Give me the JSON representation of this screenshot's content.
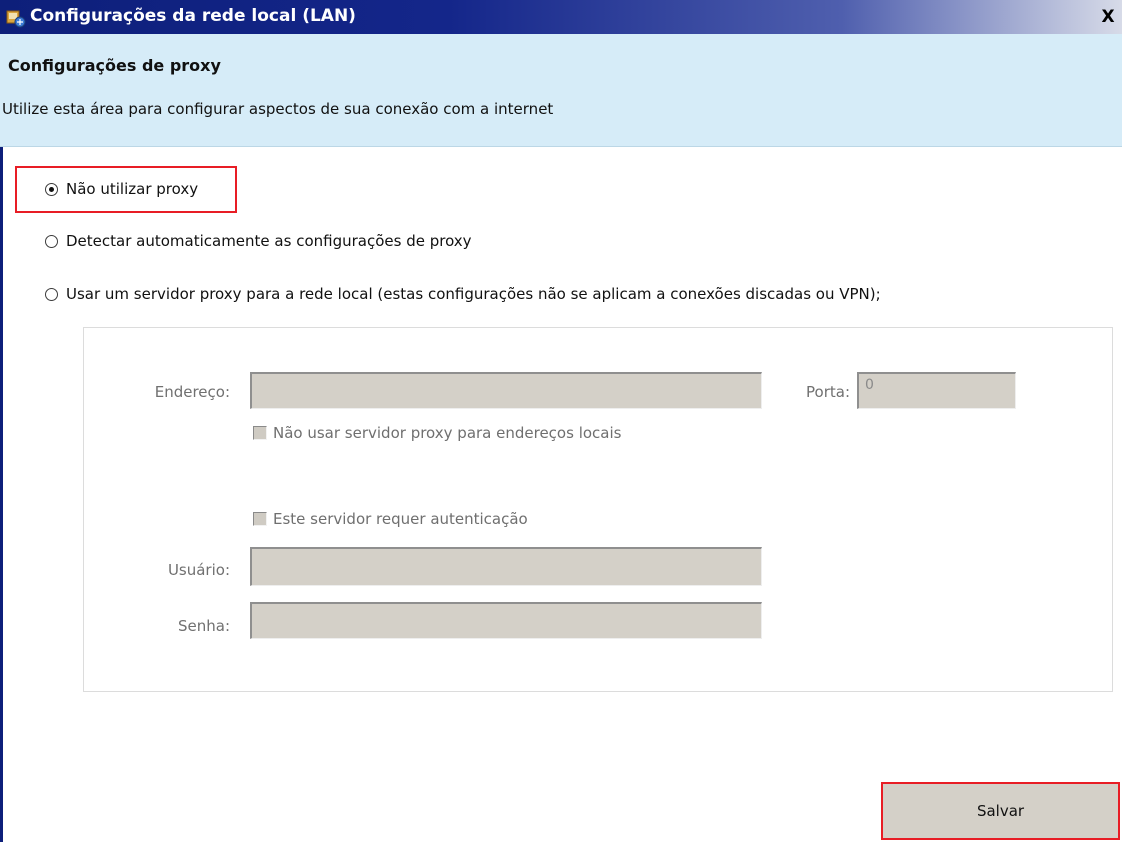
{
  "window": {
    "title": "Configurações da rede local (LAN)",
    "close_symbol": "X"
  },
  "header": {
    "heading": "Configurações de proxy",
    "description": "Utilize esta área para configurar aspectos de sua conexão com a internet"
  },
  "options": {
    "no_proxy": {
      "label": "Não utilizar proxy",
      "selected": true
    },
    "auto_detect": {
      "label": "Detectar automaticamente as configurações de proxy",
      "selected": false
    },
    "manual_proxy": {
      "label": "Usar um servidor proxy para a rede local (estas configurações não se aplicam a conexões discadas ou VPN);",
      "selected": false
    }
  },
  "proxy_settings": {
    "address_label": "Endereço:",
    "address_value": "",
    "port_label": "Porta:",
    "port_value": "0",
    "bypass_local_label": "Não usar servidor proxy para endereços locais",
    "requires_auth_label": "Este servidor requer autenticação",
    "user_label": "Usuário:",
    "user_value": "",
    "password_label": "Senha:",
    "password_value": ""
  },
  "actions": {
    "save_label": "Salvar"
  },
  "icons": {
    "title_icon": "network-settings-icon",
    "close_icon": "close-icon"
  },
  "colors": {
    "highlight": "#e81d25",
    "title_bar": "#0d1f7a",
    "banner": "#d6ecf8"
  }
}
